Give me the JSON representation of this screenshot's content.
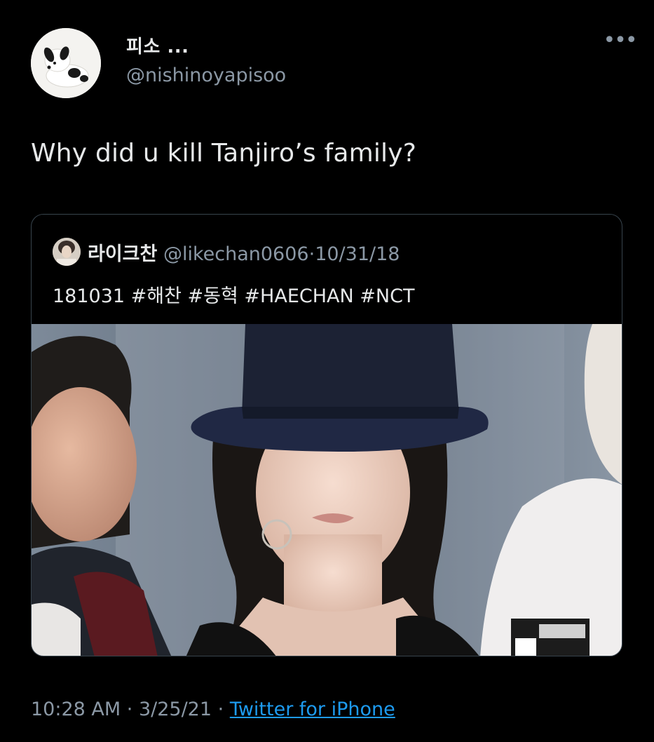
{
  "tweet": {
    "author": {
      "display_name": "피소 ...",
      "handle": "@nishinoyapisoo",
      "avatar_icon": "plush-dog-avatar"
    },
    "more_icon": "more-dots-icon",
    "more_label": "•••",
    "text": "Why did u kill Tanjiro’s family?",
    "quoted": {
      "display_name": "라이크찬",
      "handle": "@likechan0606",
      "separator": "·",
      "date": "10/31/18",
      "text": "181031 #해찬 #동혁 #HAECHAN #NCT",
      "media_icon": "photo-person-in-hat"
    },
    "footer": {
      "time": "10:28 AM",
      "sep1": "·",
      "date": "3/25/21",
      "sep2": "·",
      "source": "Twitter for iPhone"
    }
  },
  "colors": {
    "background": "#000000",
    "primary_text": "#e7e9ea",
    "secondary_text": "#8b98a5",
    "link": "#1d9bf0",
    "border": "#38444d"
  }
}
